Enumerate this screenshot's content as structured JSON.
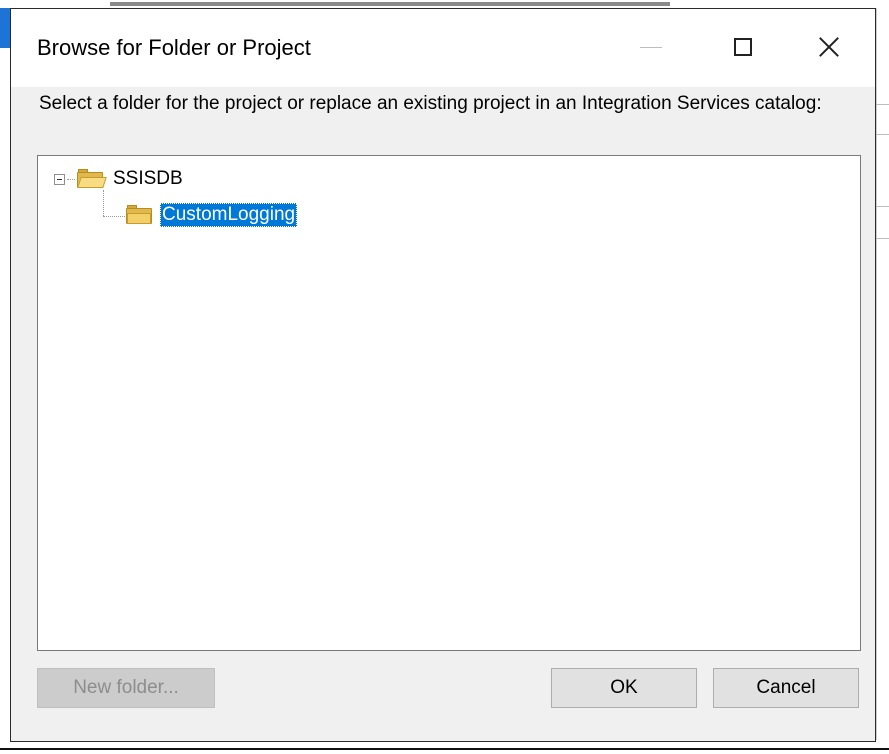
{
  "window": {
    "title": "Browse for Folder or Project",
    "controls": {
      "minimize_icon": "minimize-icon",
      "maximize_icon": "maximize-icon",
      "close_icon": "close-icon"
    }
  },
  "instruction": "Select a folder for the project or replace an existing project in an Integration Services catalog:",
  "tree": {
    "root": {
      "label": "SSISDB",
      "icon": "open-folder-icon",
      "expanded": true
    },
    "children": [
      {
        "label": "CustomLogging",
        "icon": "folder-icon",
        "selected": true
      }
    ]
  },
  "buttons": {
    "new_folder": "New folder...",
    "ok": "OK",
    "cancel": "Cancel"
  },
  "colors": {
    "selection": "#0078d7",
    "dialog_background": "#f0f0f0",
    "button_background": "#e1e1e1",
    "disabled_text": "#8d8d8d"
  }
}
